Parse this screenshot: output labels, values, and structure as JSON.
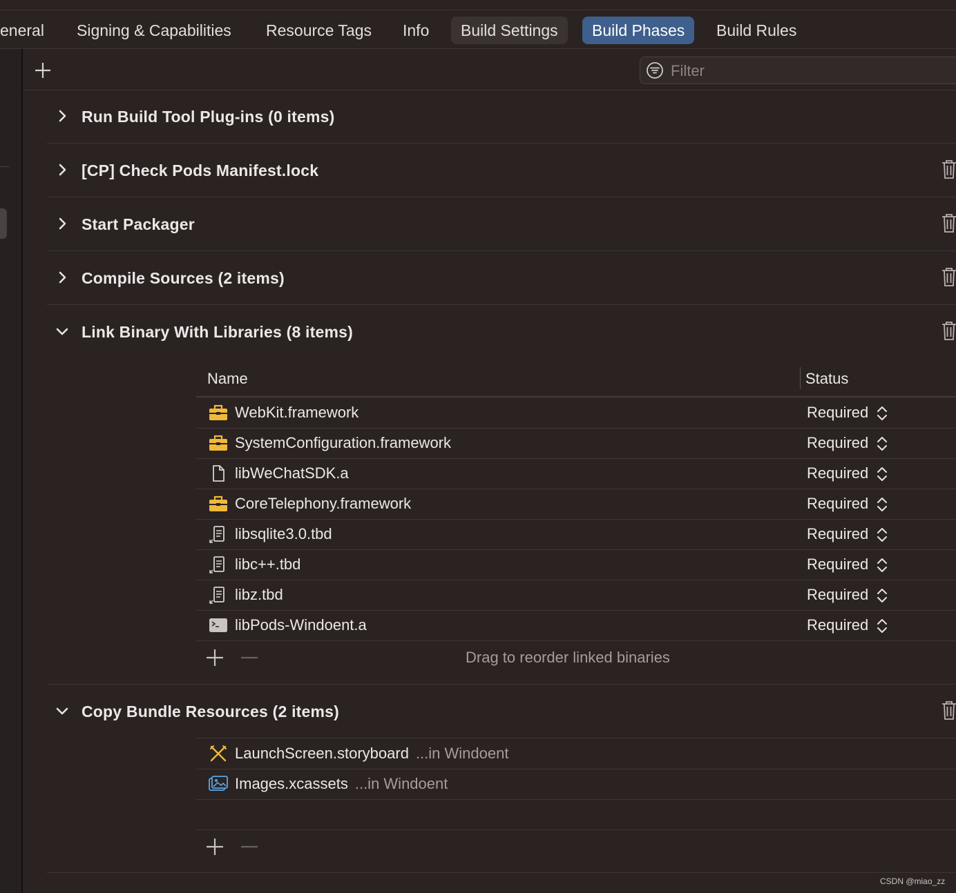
{
  "tabs": [
    {
      "label": "eneral"
    },
    {
      "label": "Signing & Capabilities"
    },
    {
      "label": "Resource Tags"
    },
    {
      "label": "Info"
    },
    {
      "label": "Build Settings"
    },
    {
      "label": "Build Phases"
    },
    {
      "label": "Build Rules"
    }
  ],
  "active_tab": "Build Phases",
  "filter": {
    "placeholder": "Filter",
    "value": ""
  },
  "phases": [
    {
      "title": "Run Build Tool Plug-ins (0 items)",
      "expanded": false
    },
    {
      "title": "[CP] Check Pods Manifest.lock",
      "expanded": false
    },
    {
      "title": "Start Packager",
      "expanded": false
    },
    {
      "title": "Compile Sources (2 items)",
      "expanded": false
    },
    {
      "title": "Link Binary With Libraries (8 items)",
      "expanded": true
    },
    {
      "title": "Copy Bundle Resources (2 items)",
      "expanded": true
    }
  ],
  "link_table": {
    "col_name": "Name",
    "col_status": "Status",
    "rows": [
      {
        "name": "WebKit.framework",
        "status": "Required",
        "icon": "framework-icon"
      },
      {
        "name": "SystemConfiguration.framework",
        "status": "Required",
        "icon": "framework-icon"
      },
      {
        "name": "libWeChatSDK.a",
        "status": "Required",
        "icon": "file-icon"
      },
      {
        "name": "CoreTelephony.framework",
        "status": "Required",
        "icon": "framework-icon"
      },
      {
        "name": "libsqlite3.0.tbd",
        "status": "Required",
        "icon": "tbd-alias-icon"
      },
      {
        "name": "libc++.tbd",
        "status": "Required",
        "icon": "tbd-alias-icon"
      },
      {
        "name": "libz.tbd",
        "status": "Required",
        "icon": "tbd-alias-icon"
      },
      {
        "name": "libPods-Windoent.a",
        "status": "Required",
        "icon": "terminal-icon"
      }
    ],
    "hint": "Drag to reorder linked binaries"
  },
  "copy_resources": [
    {
      "name": "LaunchScreen.storyboard",
      "location": "...in Windoent",
      "icon": "storyboard-icon"
    },
    {
      "name": "Images.xcassets",
      "location": "...in Windoent",
      "icon": "assets-icon"
    }
  ],
  "watermark": "CSDN @miao_zz",
  "colors": {
    "background": "#2a2322",
    "active_tab": "#3f5f8c",
    "framework_icon": "#f0b93a",
    "assets_icon": "#5aa6e6"
  }
}
